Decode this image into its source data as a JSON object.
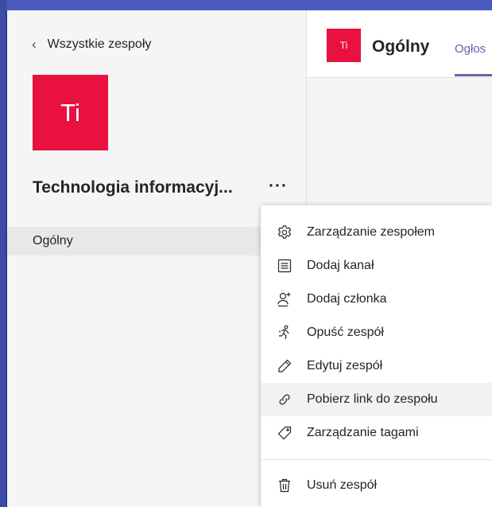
{
  "sidebar": {
    "back_label": "Wszystkie zespoły",
    "back_icon": "chevron-left-icon",
    "team_avatar_initials": "Ti",
    "team_name": "Technologia informacyj...",
    "more_label": "···",
    "channels": [
      {
        "label": "Ogólny"
      }
    ]
  },
  "header": {
    "avatar_initials": "Ti",
    "title": "Ogólny",
    "tab_label": "Ogłos"
  },
  "menu": {
    "items": [
      {
        "label": "Zarządzanie zespołem",
        "icon": "gear-icon"
      },
      {
        "label": "Dodaj kanał",
        "icon": "channel-list-icon"
      },
      {
        "label": "Dodaj członka",
        "icon": "add-person-icon"
      },
      {
        "label": "Opuść zespół",
        "icon": "leave-team-icon"
      },
      {
        "label": "Edytuj zespół",
        "icon": "pencil-icon"
      },
      {
        "label": "Pobierz link do zespołu",
        "icon": "link-icon"
      },
      {
        "label": "Zarządzanie tagami",
        "icon": "tag-icon"
      },
      {
        "label": "Usuń zespół",
        "icon": "trash-icon"
      }
    ]
  },
  "colors": {
    "team_avatar": "#e8113f",
    "accent": "#6264a7",
    "frame": "#4a5bbd"
  }
}
